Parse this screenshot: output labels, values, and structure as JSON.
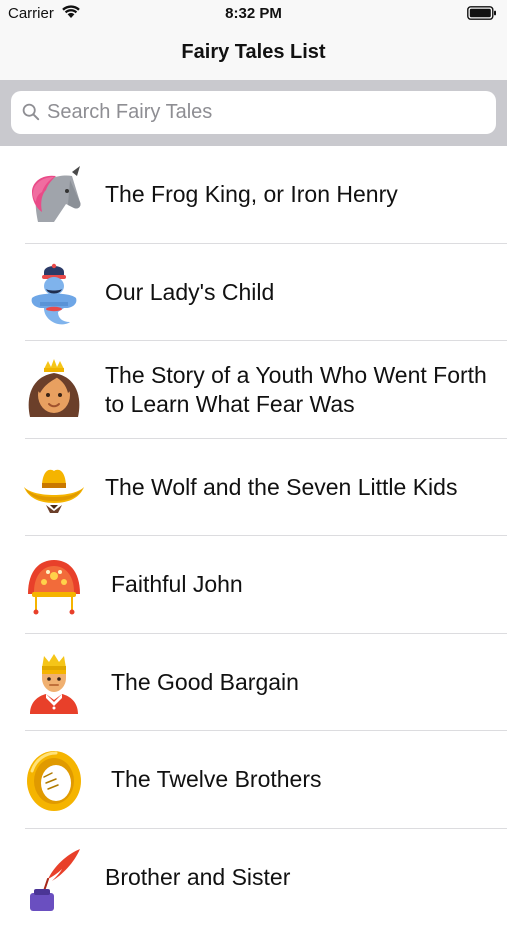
{
  "status_bar": {
    "carrier": "Carrier",
    "time": "8:32 PM",
    "wifi_icon": "wifi-icon",
    "battery_icon": "battery-icon"
  },
  "nav": {
    "title": "Fairy Tales List"
  },
  "search": {
    "placeholder": "Search Fairy Tales",
    "value": "",
    "icon": "search-icon"
  },
  "list": {
    "items": [
      {
        "title": "The Frog King, or Iron Henry",
        "icon": "unicorn-icon"
      },
      {
        "title": "Our Lady's Child",
        "icon": "genie-icon"
      },
      {
        "title": "The Story of a Youth Who Went Forth to Learn What Fear Was",
        "icon": "princess-icon"
      },
      {
        "title": "The Wolf and the Seven Little Kids",
        "icon": "cowboy-hat-icon"
      },
      {
        "title": "Faithful John",
        "icon": "kokoshnik-icon"
      },
      {
        "title": "The Good Bargain",
        "icon": "king-icon"
      },
      {
        "title": "The Twelve Brothers",
        "icon": "ring-icon"
      },
      {
        "title": "Brother and Sister",
        "icon": "quill-ink-icon"
      }
    ]
  },
  "colors": {
    "nav_background": "#f8f8f8",
    "search_bar_background": "#c9c9ce",
    "separator": "#dcdcdf",
    "placeholder": "#8e8e93"
  }
}
